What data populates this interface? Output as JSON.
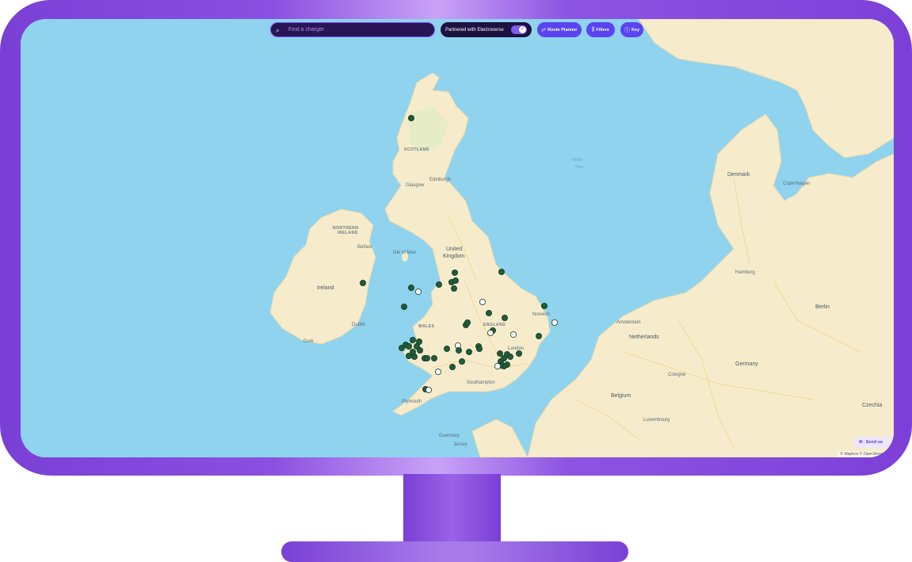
{
  "search": {
    "placeholder": "Find a charger"
  },
  "partner_toggle": {
    "label": "Partnered with Electroverse",
    "state": "on"
  },
  "buttons": {
    "route_planner": "Route Planner",
    "filters": "Filters",
    "key": "Key"
  },
  "icons": {
    "search": "search-icon",
    "route": "route-icon",
    "filters": "sliders-icon",
    "key": "info-icon",
    "send": "send-icon",
    "check": "check-icon"
  },
  "feedback": {
    "label": "Send us"
  },
  "attribution": "© Mapbox © OpenStreetMap",
  "map_labels": {
    "scotland": "SCOTLAND",
    "northern_ireland_1": "NORTHERN",
    "northern_ireland_2": "IRELAND",
    "ireland": "Ireland",
    "uk_1": "United",
    "uk_2": "Kingdom",
    "isle_of_man": "Isle of Man",
    "wales": "WALES",
    "england": "ENGLAND",
    "north_sea_1": "North",
    "north_sea_2": "Sea",
    "denmark": "Denmark",
    "netherlands": "Netherlands",
    "belgium": "Belgium",
    "germany": "Germany",
    "luxembourg": "Luxembourg",
    "czechia": "Czechia",
    "berlin": "Berlin",
    "hamburg": "Hamburg",
    "amsterdam": "Amsterdam",
    "cologne": "Cologne",
    "london": "London",
    "cork": "Cork",
    "glasgow": "Glasgow",
    "edinburgh": "Edinburgh",
    "belfast": "Belfast",
    "dublin": "Dublin",
    "norwich": "Norwich",
    "guernsey": "Guernsey",
    "jersey": "Jersey",
    "copenhagen": "Copenhagen",
    "plymouth": "Plymouth",
    "southampton": "Southampton"
  },
  "colors": {
    "accent": "#5b43f0",
    "water": "#8fd3ef",
    "land": "#f6eccb",
    "marker": "#1f5c3a",
    "marker_partner": "#ffffff"
  }
}
